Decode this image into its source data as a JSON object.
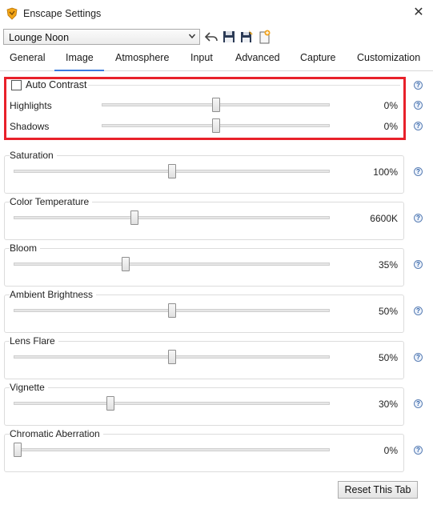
{
  "window": {
    "title": "Enscape Settings",
    "close_glyph": "✕"
  },
  "preset": {
    "selected": "Lounge Noon"
  },
  "toolbar": {
    "icons": [
      "undo-icon",
      "save-icon",
      "save-as-icon",
      "new-preset-icon"
    ]
  },
  "tabs": [
    {
      "label": "General"
    },
    {
      "label": "Image"
    },
    {
      "label": "Atmosphere"
    },
    {
      "label": "Input"
    },
    {
      "label": "Advanced"
    },
    {
      "label": "Capture"
    },
    {
      "label": "Customization"
    }
  ],
  "active_tab": "Image",
  "auto_contrast": {
    "label": "Auto Contrast",
    "checked": false
  },
  "highlight_sliders": [
    {
      "label": "Highlights",
      "value": "0%",
      "level": 0.5
    },
    {
      "label": "Shadows",
      "value": "0%",
      "level": 0.5
    }
  ],
  "sliders": [
    {
      "label": "Saturation",
      "value": "100%",
      "level": 0.5
    },
    {
      "label": "Color Temperature",
      "value": "6600K",
      "level": 0.38
    },
    {
      "label": "Bloom",
      "value": "35%",
      "level": 0.35
    },
    {
      "label": "Ambient Brightness",
      "value": "50%",
      "level": 0.5
    },
    {
      "label": "Lens Flare",
      "value": "50%",
      "level": 0.5
    },
    {
      "label": "Vignette",
      "value": "30%",
      "level": 0.3
    },
    {
      "label": "Chromatic Aberration",
      "value": "0%",
      "level": 0.0
    }
  ],
  "help_glyph": "?",
  "reset_button": {
    "label": "Reset This Tab"
  },
  "colors": {
    "highlight_border": "#e8212a",
    "accent": "#3a7be0"
  }
}
